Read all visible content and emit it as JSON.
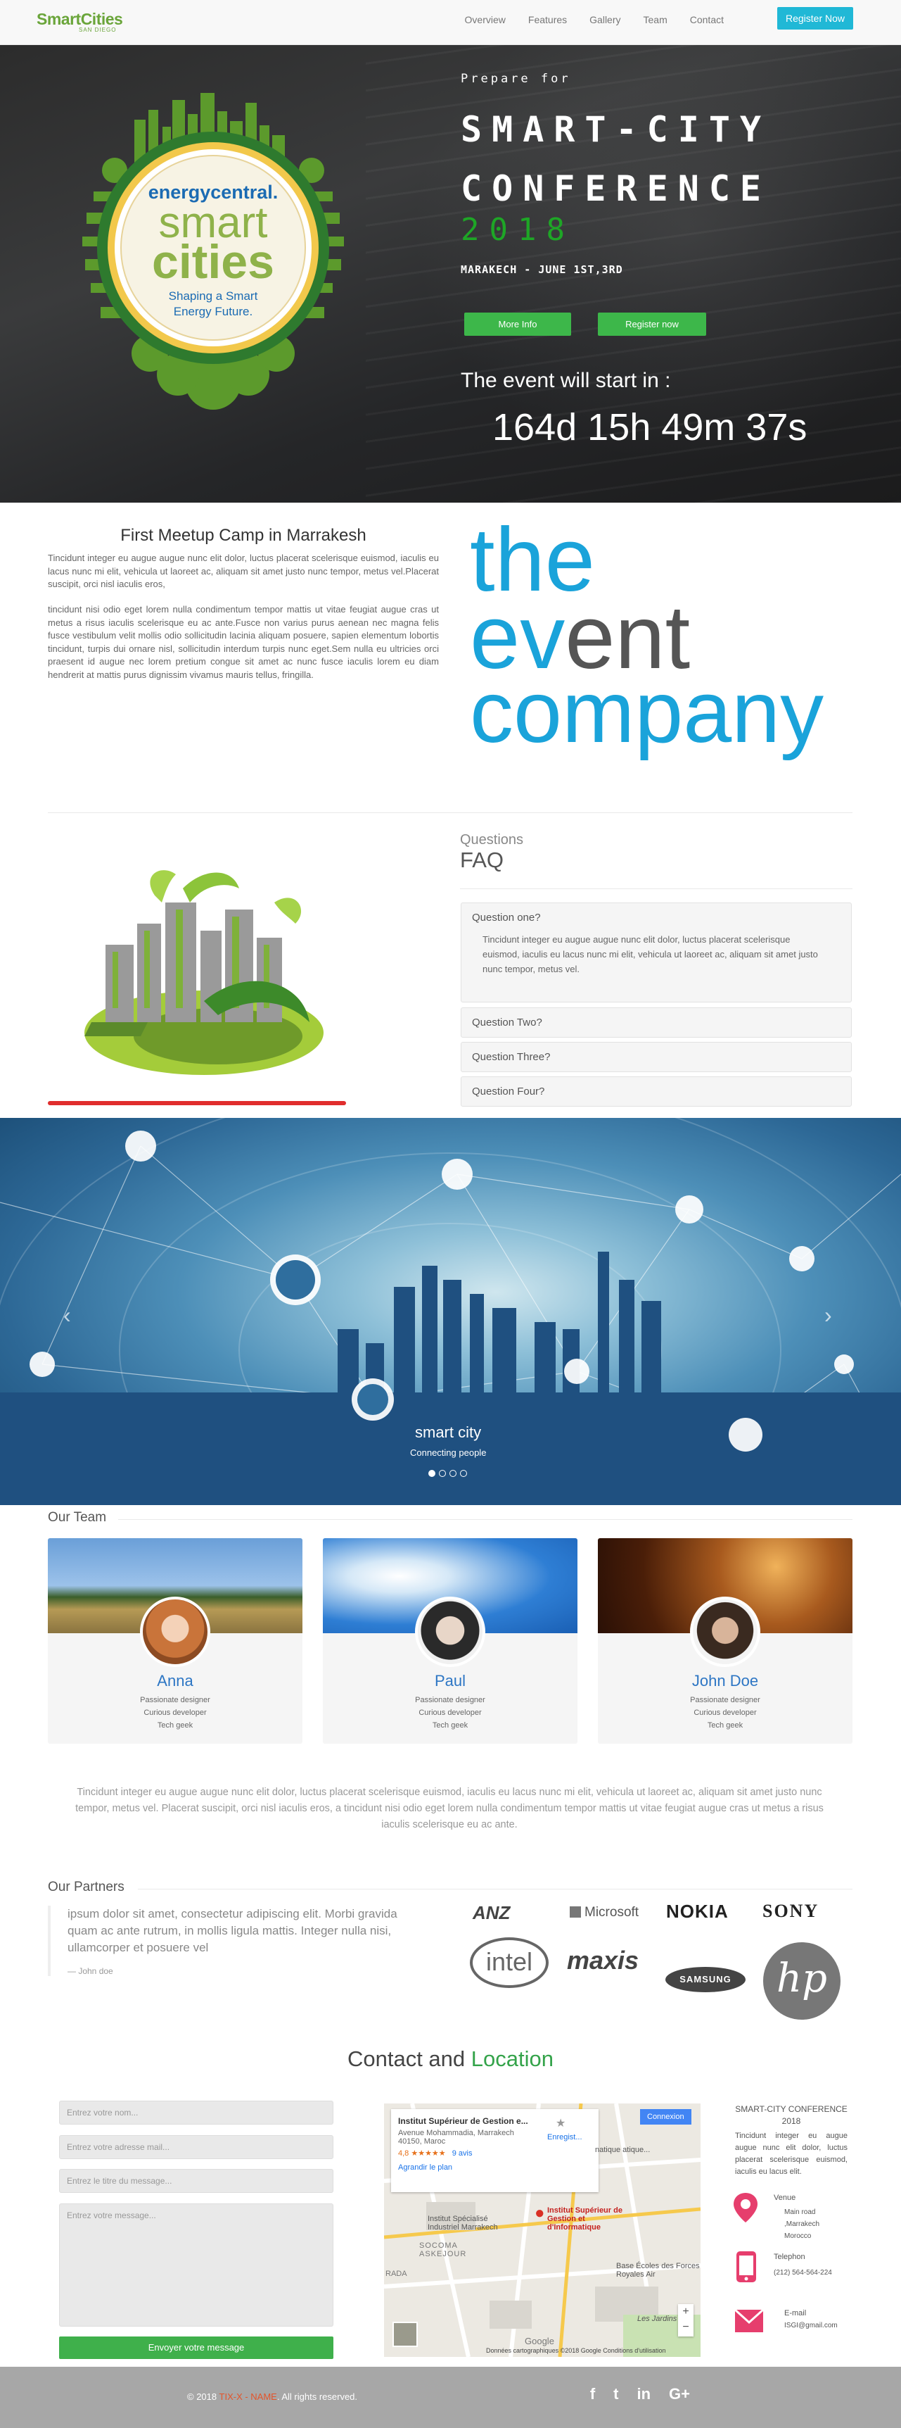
{
  "nav": {
    "logo": "SmartCities",
    "logo_sub": "SAN DIEGO",
    "links": [
      "Overview",
      "Features",
      "Gallery",
      "Team",
      "Contact"
    ],
    "register": "Register Now"
  },
  "hero": {
    "emblem_brand": "energycentral.",
    "emblem_line1": "smart",
    "emblem_line2": "cities",
    "emblem_tag1": "Shaping a Smart",
    "emblem_tag2": "Energy Future.",
    "prepare": "Prepare for",
    "title1": "SMART-CITY",
    "title2": "CONFERENCE",
    "year": "2018",
    "date": "MARAKECH - JUNE 1ST,3RD",
    "more_info": "More Info",
    "register_now": "Register now",
    "starts_in": "The event will start in :",
    "countdown": "164d 15h 49m 37s"
  },
  "meetup": {
    "title": "First Meetup Camp in Marrakesh",
    "p1": "Tincidunt integer eu augue augue nunc elit dolor, luctus placerat scelerisque euismod, iaculis eu lacus nunc mi elit, vehicula ut laoreet ac, aliquam sit amet justo nunc tempor, metus vel.Placerat suscipit, orci nisl iaculis eros,",
    "p2": "tincidunt nisi odio eget lorem nulla condimentum tempor mattis ut vitae feugiat augue cras ut metus a risus iaculis scelerisque eu ac ante.Fusce non varius purus aenean nec magna felis fusce vestibulum velit mollis odio sollicitudin lacinia aliquam posuere, sapien elementum lobortis tincidunt, turpis dui ornare nisl, sollicitudin interdum turpis nunc eget.Sem nulla eu ultricies orci praesent id augue nec lorem pretium congue sit amet ac nunc fusce iaculis lorem eu diam hendrerit at mattis purus dignissim vivamus mauris tellus, fringilla.",
    "ec_the": "the",
    "ec_ev": "ev",
    "ec_ent": "ent",
    "ec_company": "company"
  },
  "faq": {
    "kicker": "Questions",
    "title": "FAQ",
    "items": [
      {
        "q": "Question one?",
        "a": "Tincidunt integer eu augue augue nunc elit dolor, luctus placerat scelerisque euismod, iaculis eu lacus nunc mi elit, vehicula ut laoreet ac, aliquam sit amet justo nunc tempor, metus vel."
      },
      {
        "q": "Question Two?"
      },
      {
        "q": "Question Three?"
      },
      {
        "q": "Question Four?"
      }
    ]
  },
  "carousel": {
    "caption": "smart city",
    "sub": "Connecting people",
    "slide_count": 4,
    "active_index": 0
  },
  "team": {
    "heading": "Our Team",
    "members": [
      {
        "name": "Anna",
        "roles": [
          "Passionate designer",
          "Curious developer",
          "Tech geek"
        ]
      },
      {
        "name": "Paul",
        "roles": [
          "Passionate designer",
          "Curious developer",
          "Tech geek"
        ]
      },
      {
        "name": "John Doe",
        "roles": [
          "Passionate designer",
          "Curious developer",
          "Tech geek"
        ]
      }
    ],
    "paragraph": "Tincidunt integer eu augue augue nunc elit dolor, luctus placerat scelerisque euismod, iaculis eu lacus nunc mi elit, vehicula ut laoreet ac, aliquam sit amet justo nunc tempor, metus vel. Placerat suscipit, orci nisl iaculis eros, a tincidunt nisi odio eget lorem nulla condimentum tempor mattis ut vitae feugiat augue cras ut metus a risus iaculis scelerisque eu ac ante."
  },
  "partners": {
    "heading": "Our Partners",
    "quote": "ipsum dolor sit amet, consectetur adipiscing elit. Morbi gravida quam ac ante rutrum, in mollis ligula mattis. Integer nulla nisi, ullamcorper et posuere vel",
    "quote_by": "— John doe",
    "logos": [
      "ANZ",
      "Microsoft",
      "NOKIA",
      "SONY",
      "intel",
      "maxis",
      "SAMSUNG",
      "hp"
    ]
  },
  "contact": {
    "title_a": "Contact and",
    "title_b": "Location",
    "fields": [
      "Entrez votre nom...",
      "Entrez votre adresse mail...",
      "Entrez le titre du message...",
      "Entrez votre message..."
    ],
    "send": "Envoyer votre message",
    "map": {
      "place": "Institut Supérieur de Gestion e...",
      "address": "Avenue Mohammadia, Marrakech 40150, Maroc",
      "rating": "4,8 ★★★★★",
      "reviews": "9 avis",
      "enlarge": "Agrandir le plan",
      "save": "Enregist...",
      "connexion": "Connexion",
      "pin_label": "Institut Supérieur de Gestion et d'Informatique",
      "label2": "Institut Spécialisé Industriel Marrakech",
      "label3": "SOCOMA ASKEJOUR",
      "label4": "Base Écoles des Forces Royales Air",
      "label5": "Les Jardins",
      "label6": "RADA",
      "label7": "natique atique...",
      "footer": "Données cartographiques ©2018 Google    Conditions d'utilisation",
      "brand": "Google"
    },
    "info_title": "SMART-CITY CONFERENCE 2018",
    "info_text": "Tincidunt integer eu augue augue nunc elit dolor, luctus placerat scelerisque euismod, iaculis eu lacus elit.",
    "venue_label": "Venue",
    "venue": "Main road ,Marrakech Morocco",
    "phone_label": "Telephon",
    "phone": "(212) 564-564-224",
    "email_label": "E-mail",
    "email": "ISGI@gmail.com"
  },
  "footer": {
    "copy_a": "© 2018",
    "copy_brand": "TIX-X - NAME",
    "copy_b": ". All rights reserved.",
    "social": [
      "f",
      "t",
      "in",
      "G+"
    ]
  },
  "colors": {
    "accent_blue": "#20b8d6",
    "green": "#3db74a",
    "year_green": "#1ea626",
    "event_blue": "#1aa3da",
    "red": "#e02d2d"
  }
}
